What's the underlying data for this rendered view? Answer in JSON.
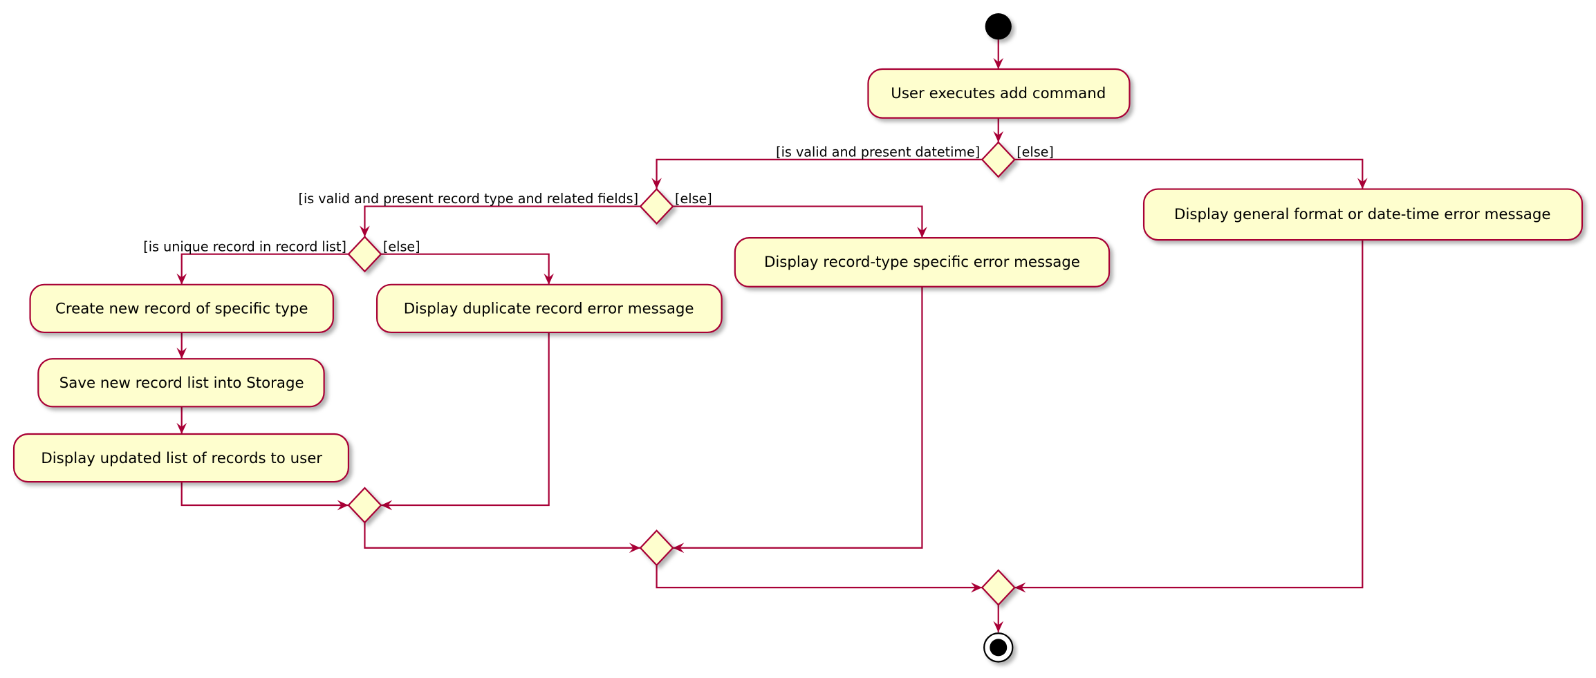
{
  "colors": {
    "border": "#A80036",
    "fill": "#FEFECE",
    "text": "#000000",
    "start_end": "#000000"
  },
  "nodes": {
    "start": "start",
    "user_executes": "User executes add command",
    "general_error": "Display general format or date-time error message",
    "record_type_error": "Display record-type specific error message",
    "create_record": "Create new record of specific type",
    "duplicate_error": "Display duplicate record error message",
    "save_storage": "Save new record list into Storage",
    "display_updated": "Display updated list of records to user",
    "end": "end"
  },
  "guards": {
    "datetime_valid": "[is valid and present datetime]",
    "datetime_else": "[else]",
    "record_type_valid": "[is valid and present record type and related fields]",
    "record_type_else": "[else]",
    "unique_record": "[is unique record in record list]",
    "unique_else": "[else]"
  }
}
